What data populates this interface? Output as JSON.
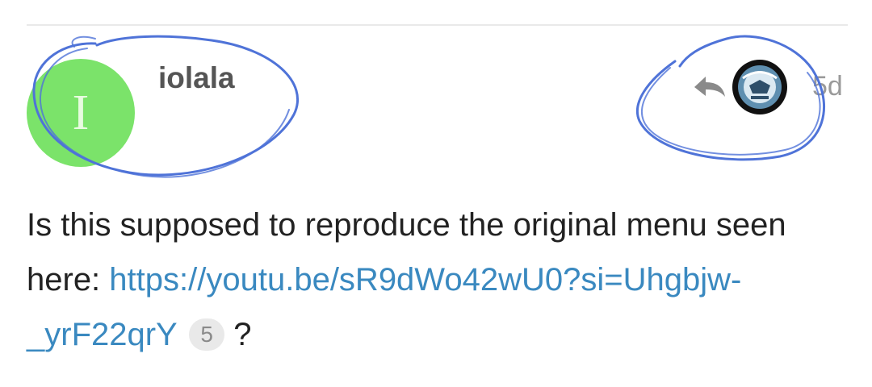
{
  "post": {
    "username": "iolala",
    "avatar_letter": "I",
    "avatar_color": "#7be36a",
    "date": "5d",
    "reply_icon": "reply-arrow-icon",
    "reply_avatar": "reply-to-user-avatar",
    "body_text": "Is this supposed to reproduce the original menu seen here: ",
    "link_text": "https://youtu.be/sR9dWo42wU0?si=Uhgbjw-_yrF22qrY",
    "link_clicks": "5",
    "body_end": " ?"
  },
  "colors": {
    "link": "#3a89c0",
    "scribble": "#4f73d8",
    "divider": "#e9e9e9"
  }
}
